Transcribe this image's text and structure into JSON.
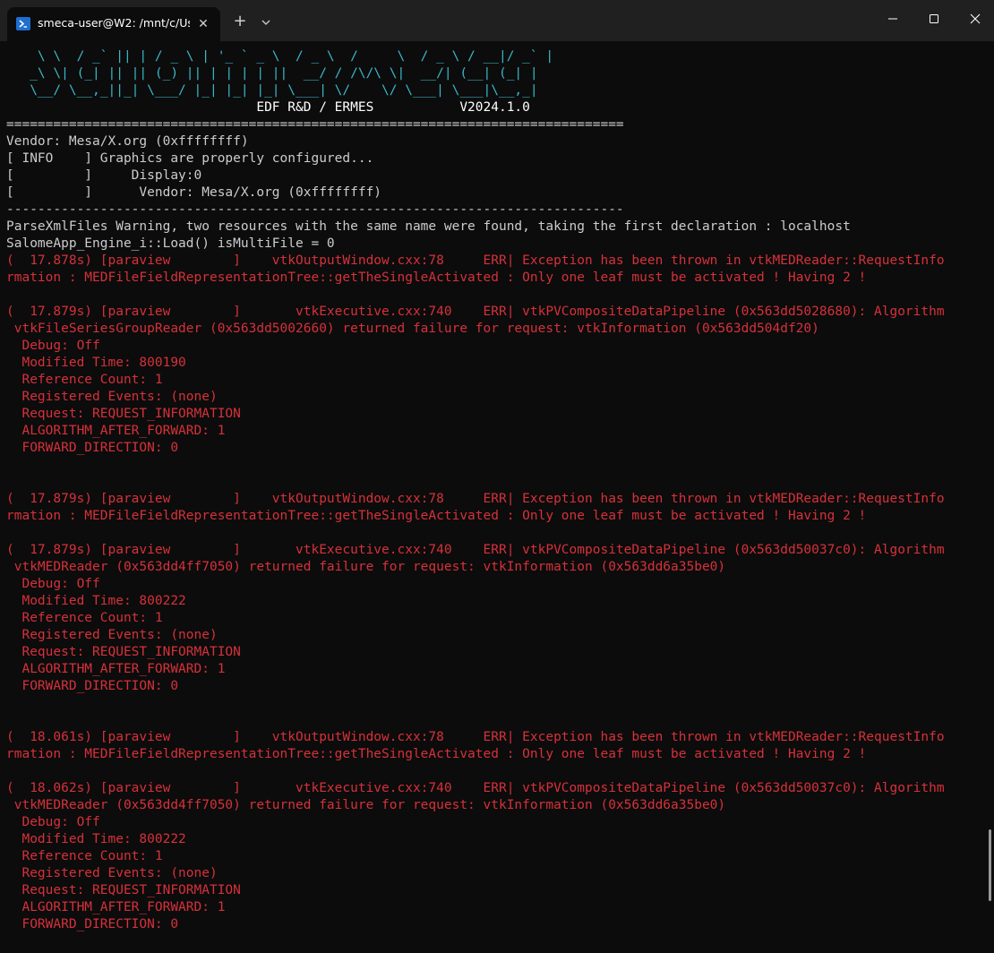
{
  "window": {
    "tab_title": "smeca-user@W2: /mnt/c/Use",
    "tab_close": "✕",
    "new_tab": "+"
  },
  "colors": {
    "background": "#0c0c0c",
    "titlebar": "#202020",
    "text": "#cccccc",
    "banner": "#3ab7c9",
    "error": "#d6313a"
  },
  "terminal": {
    "banner": [
      "    \\ \\  / _` || | / _ \\ | '_ ` _ \\  / _ \\  /     \\  / _ \\ / __|/ _` |",
      "   _\\ \\| (_| || || (_) || | | | | ||  __/ / /\\/\\ \\|  __/| (__| (_| |",
      "   \\__/ \\__,_||_| \\___/ |_| |_| |_| \\___| \\/    \\/ \\___| \\___|\\__,_|",
      "                                EDF R&D / ERMES           V2024.1.0"
    ],
    "separator_eq": "===============================================================================",
    "vendor": "Vendor: Mesa/X.org (0xffffffff)",
    "info_lines": [
      "[ INFO    ] Graphics are properly configured...",
      "[         ]     Display:0",
      "[         ]      Vendor: Mesa/X.org (0xffffffff)"
    ],
    "separator_dash": "-------------------------------------------------------------------------------",
    "parse_warning": "ParseXmlFiles Warning, two resources with the same name were found, taking the first declaration : localhost",
    "load_line": "SalomeApp_Engine_i::Load() isMultiFile = 0",
    "errors": [
      {
        "lines": [
          "(  17.878s) [paraview        ]    vtkOutputWindow.cxx:78     ERR| Exception has been thrown in vtkMEDReader::RequestInfo",
          "rmation : MEDFileFieldRepresentationTree::getTheSingleActivated : Only one leaf must be activated ! Having 2 !"
        ]
      },
      {
        "lines": [
          "(  17.879s) [paraview        ]       vtkExecutive.cxx:740    ERR| vtkPVCompositeDataPipeline (0x563dd5028680): Algorithm",
          " vtkFileSeriesGroupReader (0x563dd5002660) returned failure for request: vtkInformation (0x563dd504df20)",
          "  Debug: Off",
          "  Modified Time: 800190",
          "  Reference Count: 1",
          "  Registered Events: (none)",
          "  Request: REQUEST_INFORMATION",
          "  ALGORITHM_AFTER_FORWARD: 1",
          "  FORWARD_DIRECTION: 0"
        ]
      },
      {
        "lines": [
          "(  17.879s) [paraview        ]    vtkOutputWindow.cxx:78     ERR| Exception has been thrown in vtkMEDReader::RequestInfo",
          "rmation : MEDFileFieldRepresentationTree::getTheSingleActivated : Only one leaf must be activated ! Having 2 !"
        ]
      },
      {
        "lines": [
          "(  17.879s) [paraview        ]       vtkExecutive.cxx:740    ERR| vtkPVCompositeDataPipeline (0x563dd50037c0): Algorithm",
          " vtkMEDReader (0x563dd4ff7050) returned failure for request: vtkInformation (0x563dd6a35be0)",
          "  Debug: Off",
          "  Modified Time: 800222",
          "  Reference Count: 1",
          "  Registered Events: (none)",
          "  Request: REQUEST_INFORMATION",
          "  ALGORITHM_AFTER_FORWARD: 1",
          "  FORWARD_DIRECTION: 0"
        ]
      },
      {
        "lines": [
          "(  18.061s) [paraview        ]    vtkOutputWindow.cxx:78     ERR| Exception has been thrown in vtkMEDReader::RequestInfo",
          "rmation : MEDFileFieldRepresentationTree::getTheSingleActivated : Only one leaf must be activated ! Having 2 !"
        ]
      },
      {
        "lines": [
          "(  18.062s) [paraview        ]       vtkExecutive.cxx:740    ERR| vtkPVCompositeDataPipeline (0x563dd50037c0): Algorithm",
          " vtkMEDReader (0x563dd4ff7050) returned failure for request: vtkInformation (0x563dd6a35be0)",
          "  Debug: Off",
          "  Modified Time: 800222",
          "  Reference Count: 1",
          "  Registered Events: (none)",
          "  Request: REQUEST_INFORMATION",
          "  ALGORITHM_AFTER_FORWARD: 1",
          "  FORWARD_DIRECTION: 0"
        ]
      }
    ]
  }
}
